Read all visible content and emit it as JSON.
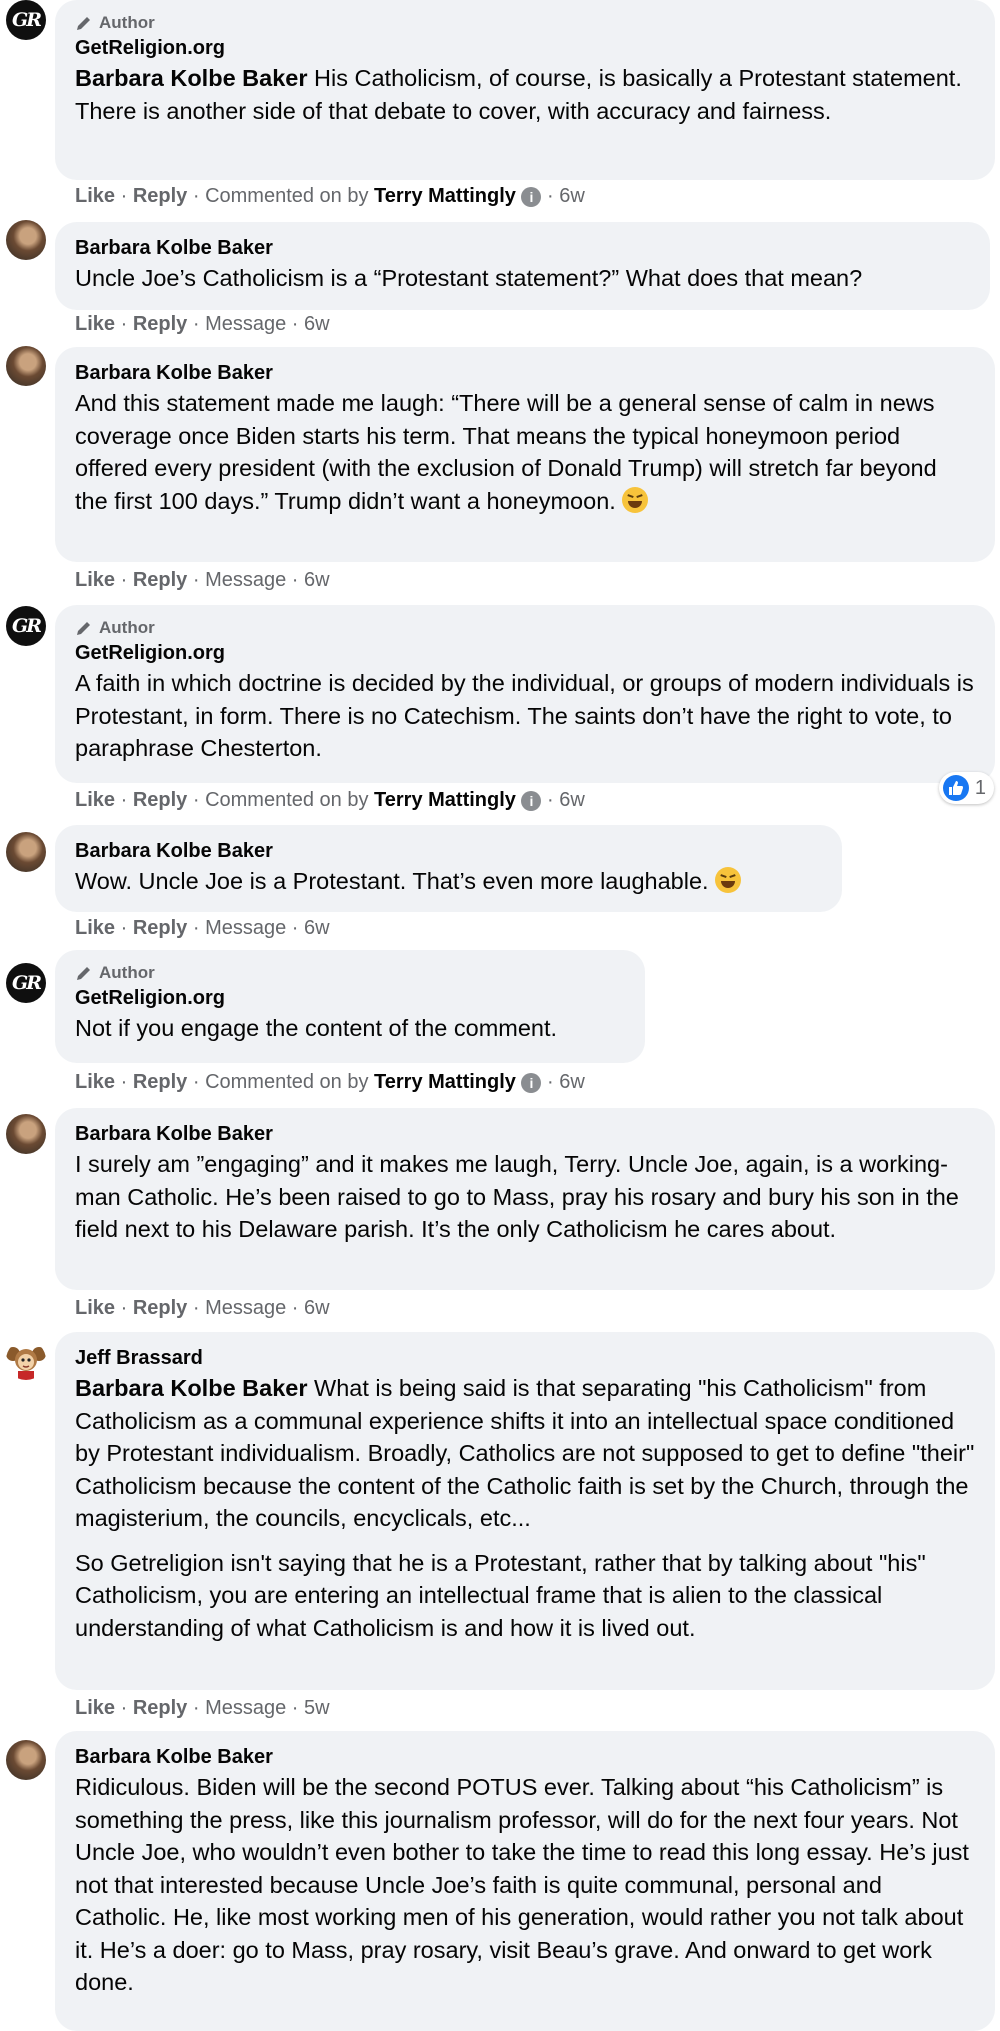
{
  "thread": {
    "author_badge": "Author",
    "actions": {
      "like": "Like",
      "reply": "Reply",
      "message": "Message",
      "commented_on_by": "Commented on by"
    },
    "separator": "·",
    "comments": [
      {
        "author": "GetReligion.org",
        "is_author": true,
        "mention": "Barbara Kolbe Baker",
        "paragraphs": [
          "His Catholicism, of course, is basically a Protestant statement. There is another side of that debate to cover, with accuracy and fairness."
        ],
        "meta_type": "commented",
        "commenter": "Terry Mattingly",
        "time": "6w"
      },
      {
        "author": "Barbara Kolbe Baker",
        "paragraphs": [
          "Uncle Joe’s Catholicism is a “Protestant statement?” What does that mean?"
        ],
        "meta_type": "message",
        "time": "6w"
      },
      {
        "author": "Barbara Kolbe Baker",
        "paragraphs": [
          "And this statement made me laugh: “There will be a general sense of calm in news coverage once Biden starts his term. That means the typical honeymoon period offered every president (with the exclusion of Donald Trump) will stretch far beyond the first 100 days.” Trump didn’t want a honeymoon."
        ],
        "emoji": "laughing-emoji",
        "meta_type": "message",
        "time": "6w"
      },
      {
        "author": "GetReligion.org",
        "is_author": true,
        "paragraphs": [
          "A faith in which doctrine is decided by the individual, or groups of modern individuals is Protestant, in form. There is no Catechism. The saints don’t have the right to vote, to paraphrase Chesterton."
        ],
        "meta_type": "commented",
        "commenter": "Terry Mattingly",
        "time": "6w",
        "reaction_count": "1"
      },
      {
        "author": "Barbara Kolbe Baker",
        "paragraphs": [
          "Wow. Uncle Joe is a Protestant. That’s even more laughable."
        ],
        "emoji": "laughing-emoji",
        "meta_type": "message",
        "time": "6w"
      },
      {
        "author": "GetReligion.org",
        "is_author": true,
        "paragraphs": [
          "Not if you engage the content of the comment."
        ],
        "meta_type": "commented",
        "commenter": "Terry Mattingly",
        "time": "6w"
      },
      {
        "author": "Barbara Kolbe Baker",
        "paragraphs": [
          "I surely am ”engaging” and it makes me laugh, Terry. Uncle Joe, again, is a working-man Catholic. He’s been raised to go to Mass, pray his rosary and bury his son in the field next to his Delaware parish. It’s the only Catholicism he cares about."
        ],
        "meta_type": "message",
        "time": "6w"
      },
      {
        "author": "Jeff Brassard",
        "mention": "Barbara Kolbe Baker",
        "paragraphs": [
          "What is being said is that separating \"his Catholicism\" from Catholicism as a communal experience shifts it into an intellectual space conditioned by Protestant individualism. Broadly, Catholics are not supposed to get to define \"their\" Catholicism because the content of the Catholic faith is set by the Church, through the magisterium, the councils, encyclicals, etc...",
          "So Getreligion isn't saying that he is a Protestant, rather that by talking about \"his\" Catholicism, you are entering an intellectual frame that is alien to the classical understanding of what Catholicism is and how it is lived out."
        ],
        "meta_type": "message",
        "time": "5w"
      },
      {
        "author": "Barbara Kolbe Baker",
        "paragraphs": [
          "Ridiculous. Biden will be the second POTUS ever. Talking about “his Catholicism” is something the press, like this journalism professor, will do for the next four years. Not Uncle Joe, who wouldn’t even bother to take the time to read this long essay. He’s just not that interested because Uncle Joe’s faith is quite communal, personal and Catholic. He, like most working men of his generation, would rather you not talk about it. He’s a doer: go to Mass, pray rosary, visit Beau’s grave. And onward to get work done."
        ]
      }
    ]
  }
}
